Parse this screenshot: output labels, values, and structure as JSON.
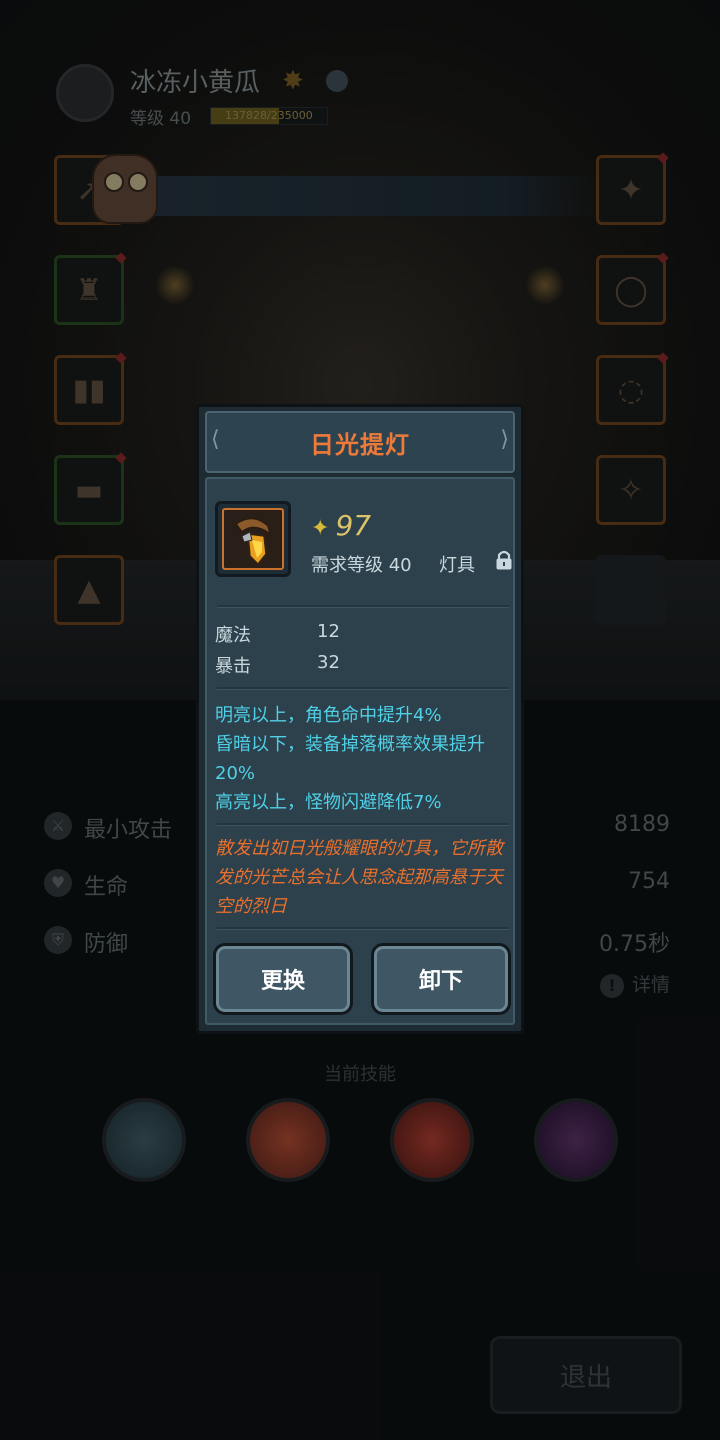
{
  "player": {
    "name": "冰冻小黄瓜",
    "level_label": "等级 40",
    "exp_text": "137828/235000",
    "exp_progress": 0.586
  },
  "stats": [
    {
      "label": "最小攻击",
      "value": "8189"
    },
    {
      "label": "生命",
      "value": "754"
    },
    {
      "label": "防御",
      "value": "0.75秒"
    }
  ],
  "detail_label": "详情",
  "skills_title": "当前技能",
  "exit_label": "退出",
  "item": {
    "name": "日光提灯",
    "power": "97",
    "required_level": "需求等级 40",
    "type": "灯具",
    "attributes": [
      {
        "name": "魔法",
        "value": "12"
      },
      {
        "name": "暴击",
        "value": "32"
      }
    ],
    "effects": [
      "明亮以上，角色命中提升4%",
      "昏暗以下，装备掉落概率效果提升20%",
      "高亮以上，怪物闪避降低7%"
    ],
    "lore": "散发出如日光般耀眼的灯具，它所散发的光芒总会让人思念起那高悬于天空的烈日"
  },
  "buttons": {
    "replace": "更换",
    "unequip": "卸下"
  },
  "colors": {
    "title": "#ee7a3a",
    "effect_text": "#4fd0e6",
    "lore_text": "#e8702e",
    "power": "#dcc36a"
  }
}
